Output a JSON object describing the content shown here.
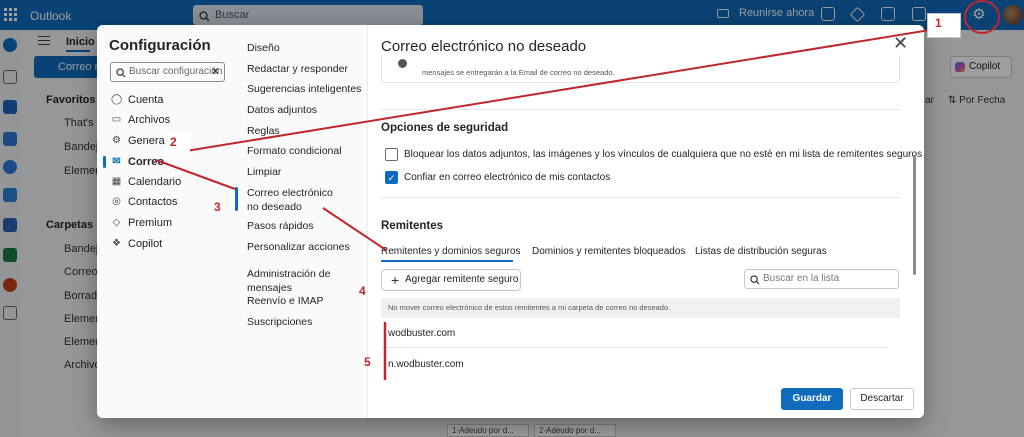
{
  "app": {
    "title": "Outlook",
    "search_placeholder": "Buscar",
    "meet_now": "Reunirse ahora",
    "tab_home": "Inicio",
    "new_mail": "Correo nuevo",
    "copilot": "Copilot",
    "sort_label": "Por Fecha",
    "sort_left": "ar",
    "favorites_header": "Favoritos",
    "favorites": [
      "That's",
      "Bandeja",
      "Element"
    ],
    "folders_header": "Carpetas",
    "folders": [
      "Bandeja",
      "Correo n",
      "Borrado",
      "Element",
      "Element",
      "Archivo"
    ],
    "attachments": [
      "1-Adeudo por d...",
      "2-Adeudo por d..."
    ]
  },
  "settings": {
    "title": "Configuración",
    "search_placeholder": "Buscar configuración",
    "categories": [
      {
        "label": "Cuenta",
        "icon": "person-icon"
      },
      {
        "label": "Archivos",
        "icon": "paperclip-icon"
      },
      {
        "label": "General",
        "icon": "gear-icon"
      },
      {
        "label": "Correo",
        "icon": "mail-icon"
      },
      {
        "label": "Calendario",
        "icon": "calendar-icon"
      },
      {
        "label": "Contactos",
        "icon": "people-icon"
      },
      {
        "label": "Premium",
        "icon": "diamond-icon"
      },
      {
        "label": "Copilot",
        "icon": "copilot-icon"
      }
    ],
    "subcategories": [
      "Diseño",
      "Redactar y responder",
      "Sugerencias inteligentes",
      "Datos adjuntos",
      "Reglas",
      "Formato condicional",
      "Limpiar",
      "Correo electrónico no deseado",
      "Pasos rápidos",
      "Personalizar acciones",
      "Administración de mensajes",
      "Reenvío e IMAP",
      "Suscripciones"
    ]
  },
  "junk": {
    "title": "Correo electrónico no deseado",
    "info_text": "mensajes se entregarán a la Email de correo no deseado.",
    "security_header": "Opciones de seguridad",
    "block_attachments_label": "Bloquear los datos adjuntos, las imágenes y los vínculos de cualquiera que no esté en mi lista de remitentes seguros",
    "block_attachments_checked": false,
    "trust_contacts_label": "Confiar en correo electrónico de mis contactos",
    "trust_contacts_checked": true,
    "senders_header": "Remitentes",
    "tabs": [
      "Remitentes y dominios seguros",
      "Dominios y remitentes bloqueados",
      "Listas de distribución seguras"
    ],
    "active_tab": 0,
    "add_button": "Agregar remitente seguro",
    "list_search_placeholder": "Buscar en la lista",
    "list_note": "No mover correo electrónico de estos remitentes a mi carpeta de correo no deseado.",
    "senders": [
      "wodbuster.com",
      "n.wodbuster.com"
    ],
    "save_button": "Guardar",
    "discard_button": "Descartar"
  },
  "annotations": {
    "labels": [
      "1",
      "2",
      "3",
      "4",
      "5"
    ],
    "color": "#c0262d"
  },
  "colors": {
    "brand": "#0f6cbd",
    "annotation": "#c0262d"
  }
}
